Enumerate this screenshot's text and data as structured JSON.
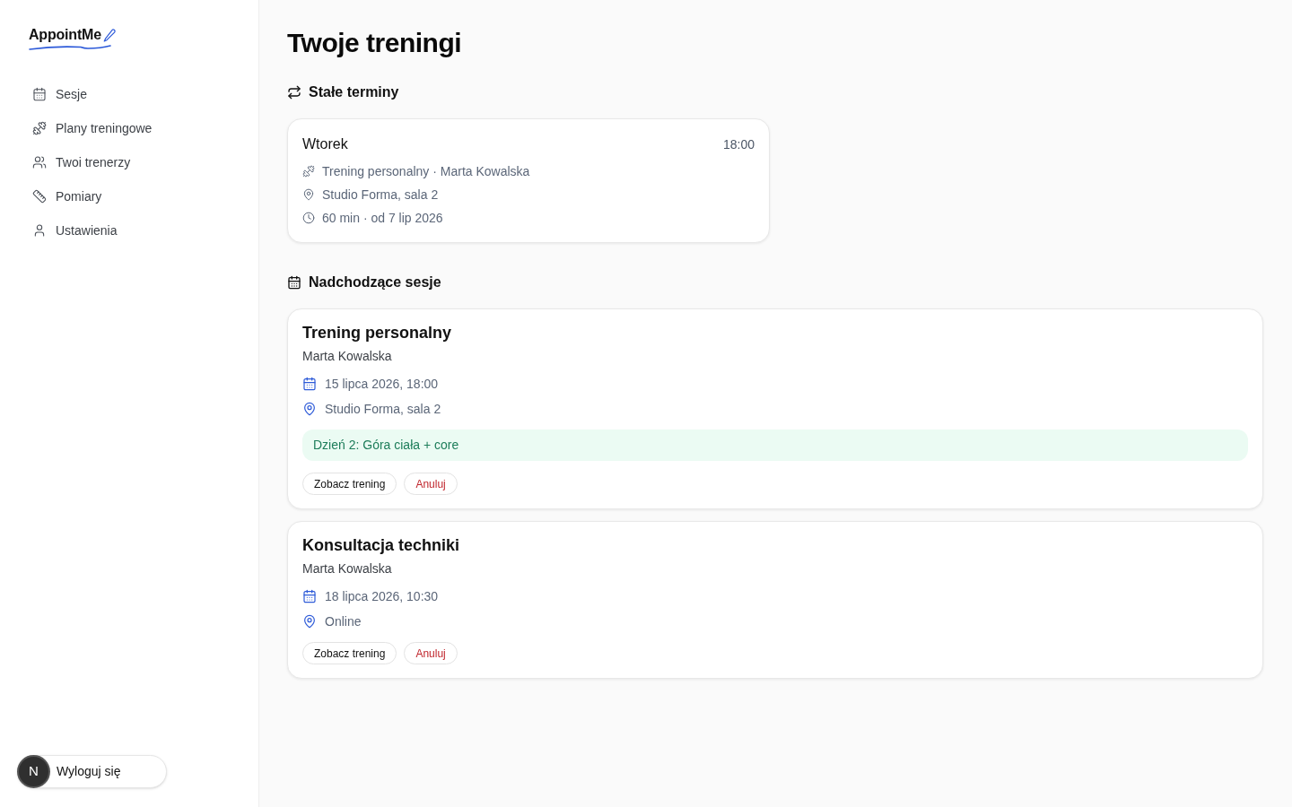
{
  "sidebar": {
    "logo": "AppointMe",
    "nav": [
      {
        "kind": "sessions",
        "label": "Sesje"
      },
      {
        "kind": "plans",
        "label": "Plany treningowe"
      },
      {
        "kind": "trainers",
        "label": "Twoi trenerzy"
      },
      {
        "kind": "measurements",
        "label": "Pomiary"
      },
      {
        "kind": "settings",
        "label": "Ustawienia"
      }
    ],
    "user_initial": "N",
    "logout": "Wyloguj się"
  },
  "page": {
    "title": "Twoje treningi"
  },
  "recurring": {
    "heading": "Stałe terminy",
    "items": [
      {
        "day": "Wtorek",
        "time": "18:00",
        "details": [
          {
            "kind": "session",
            "text": "Trening personalny · Marta Kowalska"
          },
          {
            "kind": "location",
            "text": "Studio Forma, sala 2"
          },
          {
            "kind": "duration",
            "text": "60 min · od 7 lip 2026"
          }
        ]
      }
    ]
  },
  "upcoming": {
    "heading": "Nadchodzące sesje",
    "sessions": [
      {
        "title": "Trening personalny",
        "trainer": "Marta Kowalska",
        "date": "15 lipca 2026, 18:00",
        "location": "Studio Forma, sala 2",
        "plan_note": "Dzień 2: Góra ciała + core",
        "actions": [
          {
            "kind": "view",
            "label": "Zobacz trening"
          },
          {
            "kind": "cancel",
            "label": "Anuluj"
          }
        ]
      },
      {
        "title": "Konsultacja techniki",
        "trainer": "Marta Kowalska",
        "date": "18 lipca 2026, 10:30",
        "location": "Online",
        "actions": [
          {
            "kind": "view",
            "label": "Zobacz trening"
          },
          {
            "kind": "cancel",
            "label": "Anuluj"
          }
        ]
      }
    ]
  }
}
